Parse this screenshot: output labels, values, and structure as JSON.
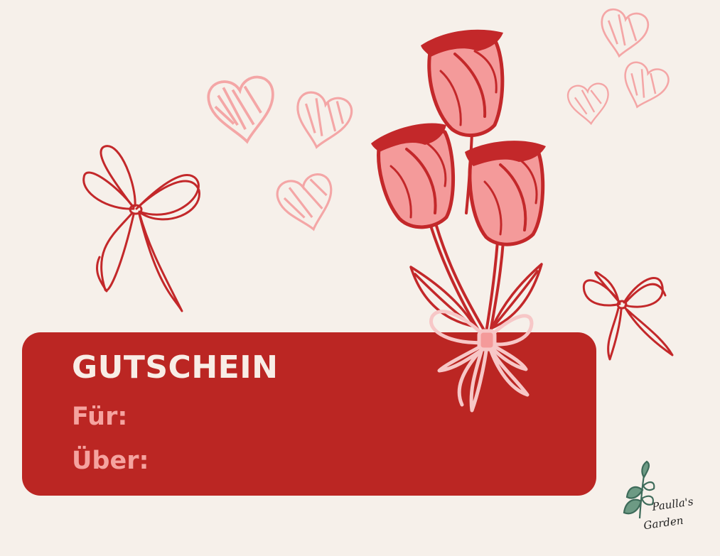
{
  "voucher": {
    "title": "GUTSCHEIN",
    "for_label": "Für:",
    "about_label": "Über:"
  },
  "logo": {
    "line1": "Paulla's",
    "line2": "Garden",
    "icon": "leaf-sprig-icon"
  },
  "colors": {
    "background": "#f6f0ea",
    "panel": "#bb2623",
    "title_text": "#f8ede6",
    "field_text": "#f5a39f",
    "rose_outline": "#c3282a",
    "rose_fill": "#f49a9a",
    "heart": "#f4a6a6",
    "leaf": "#4e7a6a"
  },
  "decorations": [
    "rose-bouquet-icon",
    "heart-icon",
    "ribbon-bow-icon"
  ]
}
